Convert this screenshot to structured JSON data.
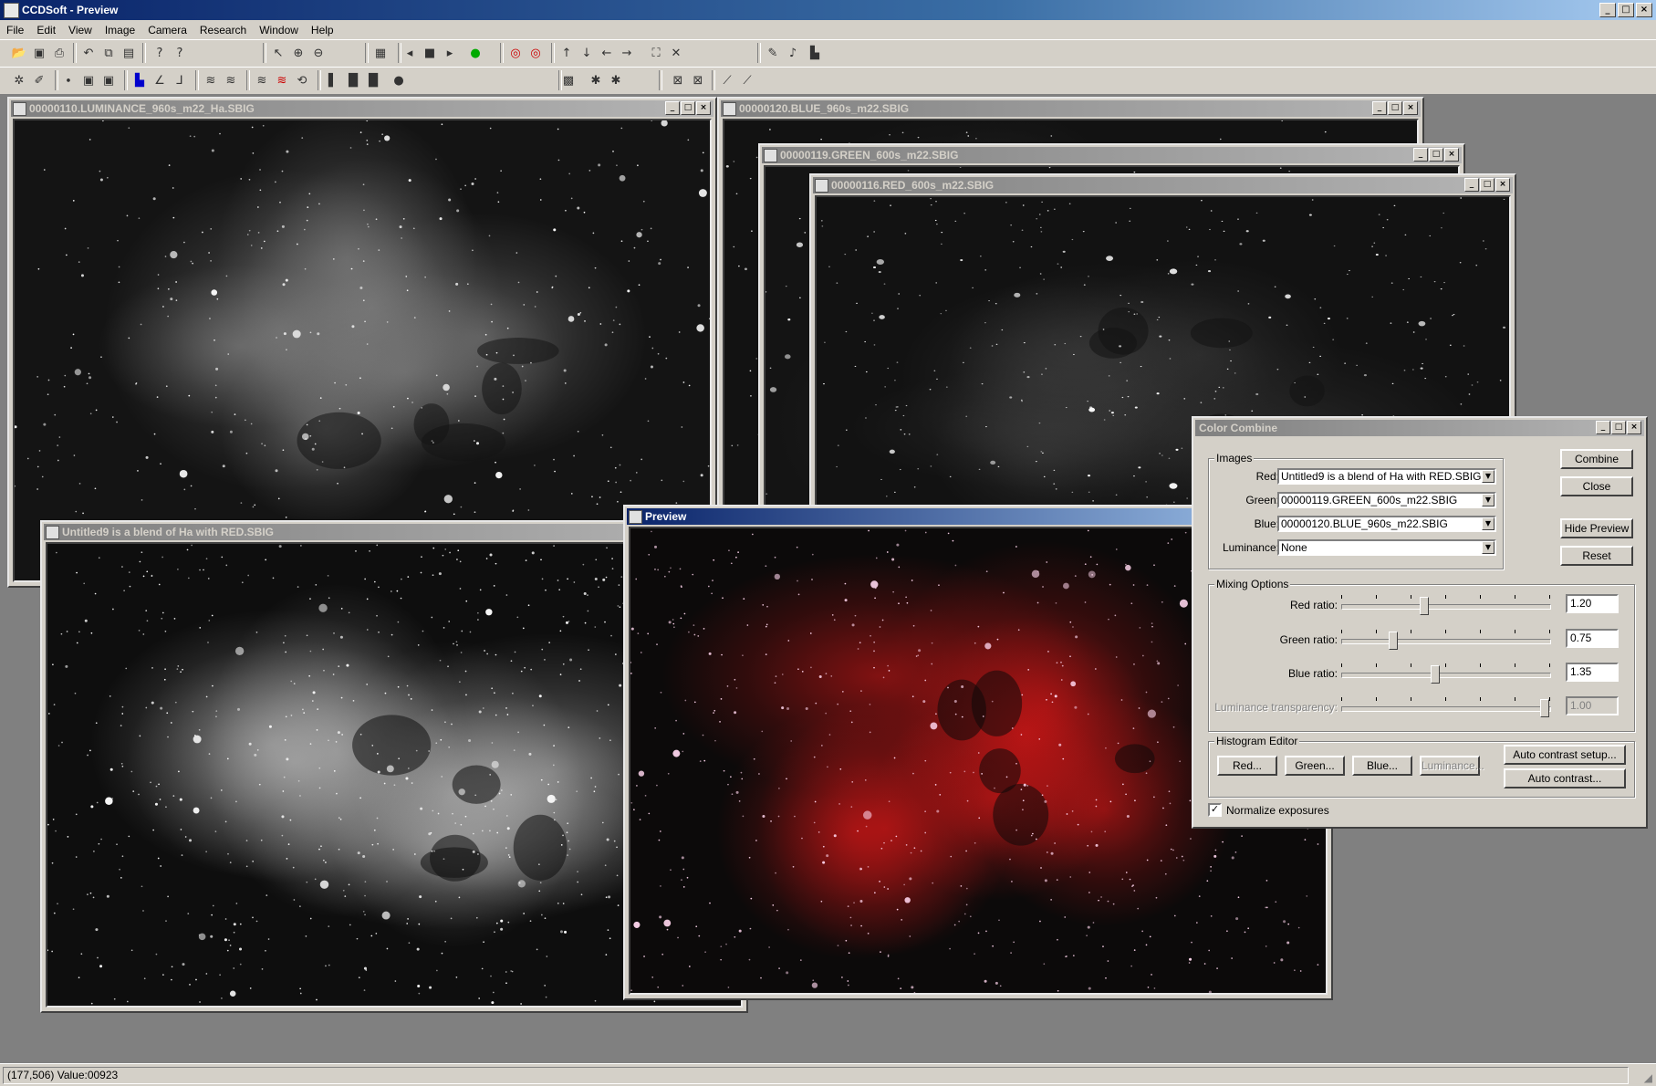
{
  "app": {
    "title": "CCDSoft  - Preview"
  },
  "menu": [
    "File",
    "Edit",
    "View",
    "Image",
    "Camera",
    "Research",
    "Window",
    "Help"
  ],
  "windows": {
    "luminance": {
      "title": "00000110.LUMINANCE_960s_m22_Ha.SBIG"
    },
    "blue": {
      "title": "00000120.BLUE_960s_m22.SBIG"
    },
    "green": {
      "title": "00000119.GREEN_600s_m22.SBIG"
    },
    "red": {
      "title": "00000116.RED_600s_m22.SBIG"
    },
    "untitled": {
      "title": "Untitled9 is a blend of Ha with RED.SBIG"
    },
    "preview": {
      "title": "Preview"
    }
  },
  "dialog": {
    "title": "Color Combine",
    "images_group": "Images",
    "red_label": "Red:",
    "red_value": "Untitled9 is a blend of Ha with RED.SBIG",
    "green_label": "Green:",
    "green_value": "00000119.GREEN_600s_m22.SBIG",
    "blue_label": "Blue:",
    "blue_value": "00000120.BLUE_960s_m22.SBIG",
    "lum_label": "Luminance:",
    "lum_value": "None",
    "combine": "Combine",
    "close": "Close",
    "hide_preview": "Hide Preview",
    "reset": "Reset",
    "mixing_group": "Mixing Options",
    "red_ratio_label": "Red ratio:",
    "red_ratio": "1.20",
    "green_ratio_label": "Green ratio:",
    "green_ratio": "0.75",
    "blue_ratio_label": "Blue ratio:",
    "blue_ratio": "1.35",
    "lum_trans_label": "Luminance transparency:",
    "lum_trans": "1.00",
    "histogram_group": "Histogram Editor",
    "hist_red": "Red...",
    "hist_green": "Green...",
    "hist_blue": "Blue...",
    "hist_lum": "Luminance...",
    "auto_contrast_setup": "Auto contrast setup...",
    "auto_contrast": "Auto contrast...",
    "normalize": "Normalize exposures",
    "normalize_checked": true
  },
  "status": {
    "text": "(177,506) Value:00923"
  }
}
